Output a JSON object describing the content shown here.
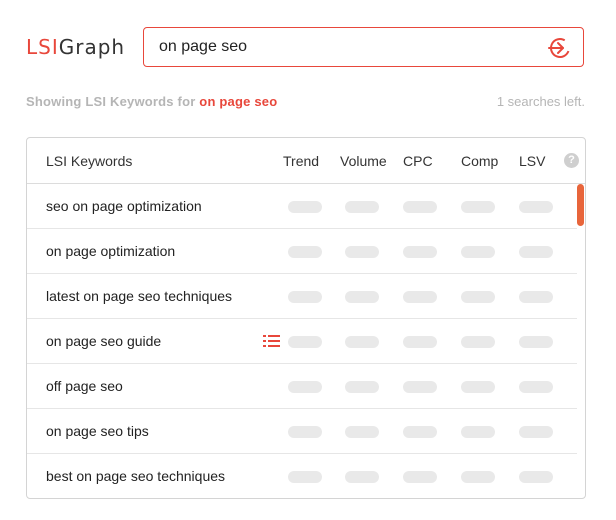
{
  "logo": {
    "part1": "LSI",
    "part2": "Graph"
  },
  "search": {
    "value": "on page seo"
  },
  "status": {
    "prefix": "Showing LSI Keywords for",
    "keyword": "on page seo",
    "searches_left": "1 searches left."
  },
  "table": {
    "headers": {
      "keyword": "LSI Keywords",
      "trend": "Trend",
      "volume": "Volume",
      "cpc": "CPC",
      "comp": "Comp",
      "lsv": "LSV",
      "help": "?"
    },
    "rows": [
      {
        "keyword": "seo on page optimization"
      },
      {
        "keyword": "on page optimization"
      },
      {
        "keyword": "latest on page seo techniques"
      },
      {
        "keyword": "on page seo guide",
        "list_icon": "list-icon"
      },
      {
        "keyword": "off page seo"
      },
      {
        "keyword": "on page seo tips"
      },
      {
        "keyword": "best on page seo techniques"
      }
    ]
  },
  "colors": {
    "accent": "#e8473b",
    "muted": "#b5b5b5",
    "placeholder_pill": "#e9e9e9",
    "scrollbar": "#e8653b"
  },
  "icons": {
    "search_go": "sign-in-arrow-icon",
    "list": "list-icon",
    "help": "help-icon"
  }
}
